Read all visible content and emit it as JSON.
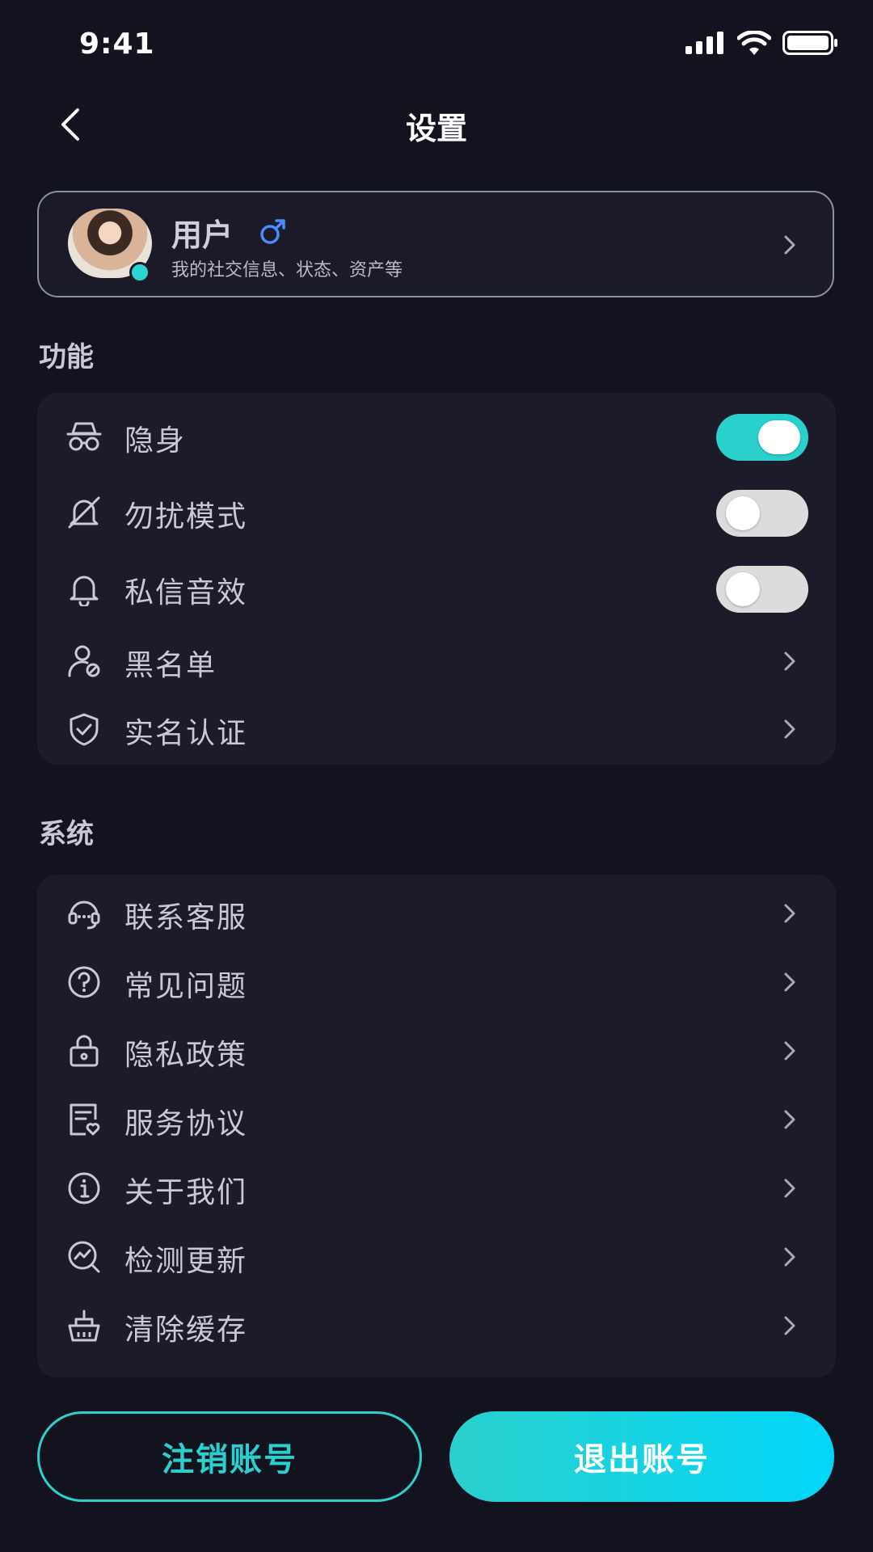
{
  "status_bar": {
    "time": "9:41"
  },
  "header": {
    "title": "设置"
  },
  "profile": {
    "name": "用户",
    "subtitle": "我的社交信息、状态、资产等",
    "gender_color": "#4a8cff",
    "online_color": "#2ad6cf"
  },
  "sections": {
    "features": {
      "title": "功能",
      "items": [
        {
          "label": "隐身",
          "icon": "incognito-icon",
          "type": "toggle",
          "on": true
        },
        {
          "label": "勿扰模式",
          "icon": "bell-off-icon",
          "type": "toggle",
          "on": false
        },
        {
          "label": "私信音效",
          "icon": "bell-icon",
          "type": "toggle",
          "on": false
        },
        {
          "label": "黑名单",
          "icon": "user-block-icon",
          "type": "link"
        },
        {
          "label": "实名认证",
          "icon": "shield-check-icon",
          "type": "link"
        }
      ]
    },
    "system": {
      "title": "系统",
      "items": [
        {
          "label": "联系客服",
          "icon": "headset-icon"
        },
        {
          "label": "常见问题",
          "icon": "question-icon"
        },
        {
          "label": "隐私政策",
          "icon": "lock-icon"
        },
        {
          "label": "服务协议",
          "icon": "agreement-icon"
        },
        {
          "label": "关于我们",
          "icon": "info-icon"
        },
        {
          "label": "检测更新",
          "icon": "update-check-icon"
        },
        {
          "label": "清除缓存",
          "icon": "clear-cache-icon"
        }
      ]
    }
  },
  "buttons": {
    "deactivate": "注销账号",
    "logout": "退出账号"
  },
  "colors": {
    "background": "#13131f",
    "card": "#1b1b2a",
    "accent": "#2ad0cc",
    "accent_gradient_end": "#02d6f8",
    "toggle_off": "#dcdcdc"
  }
}
